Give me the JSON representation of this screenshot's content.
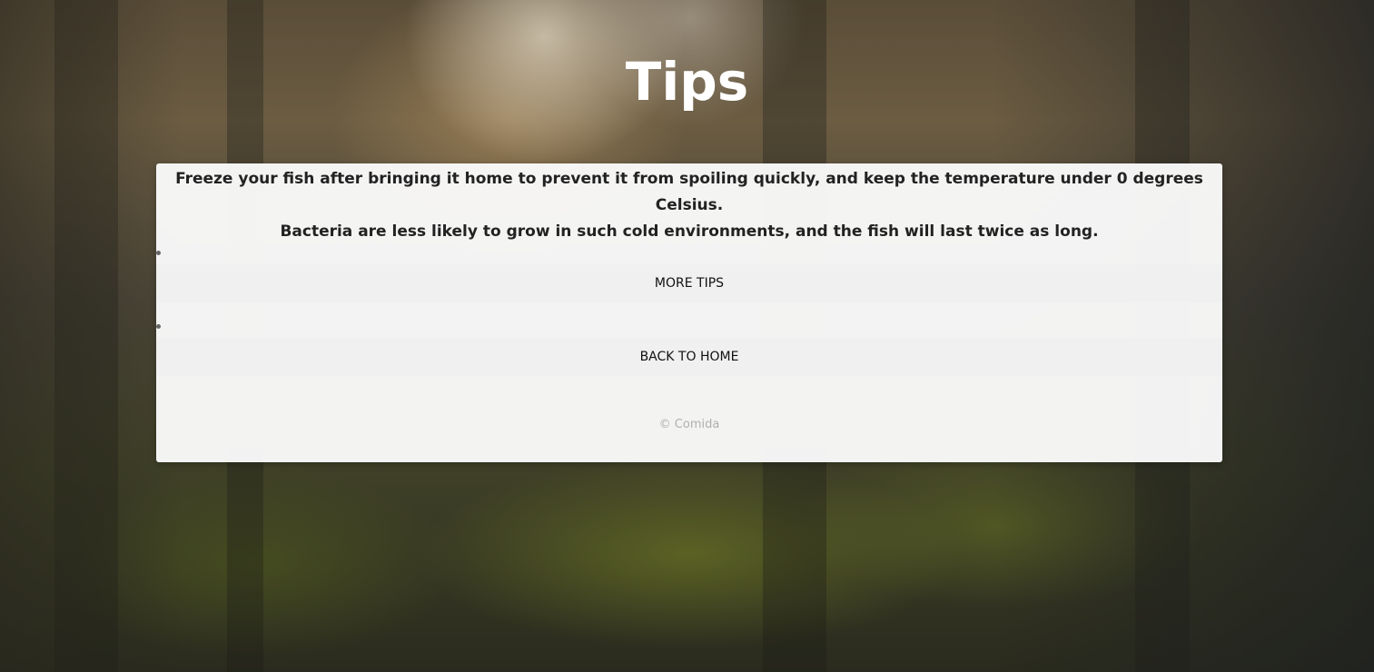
{
  "page": {
    "title": "Tips"
  },
  "tip": {
    "line1": "Freeze your fish after bringing it home to prevent it from spoiling quickly, and keep the temperature under 0 degrees Celsius.",
    "line2": "Bacteria are less likely to grow in such cold environments, and the fish will last twice as long."
  },
  "nav": {
    "items": [
      {
        "label": "MORE TIPS"
      },
      {
        "label": "BACK TO HOME"
      }
    ]
  },
  "footer": {
    "text": "© Comida"
  },
  "colors": {
    "card_background": "#fafafa",
    "button_background": "#f0f0f0",
    "title_color": "#ffffff",
    "footer_color": "#b0b0b0"
  }
}
